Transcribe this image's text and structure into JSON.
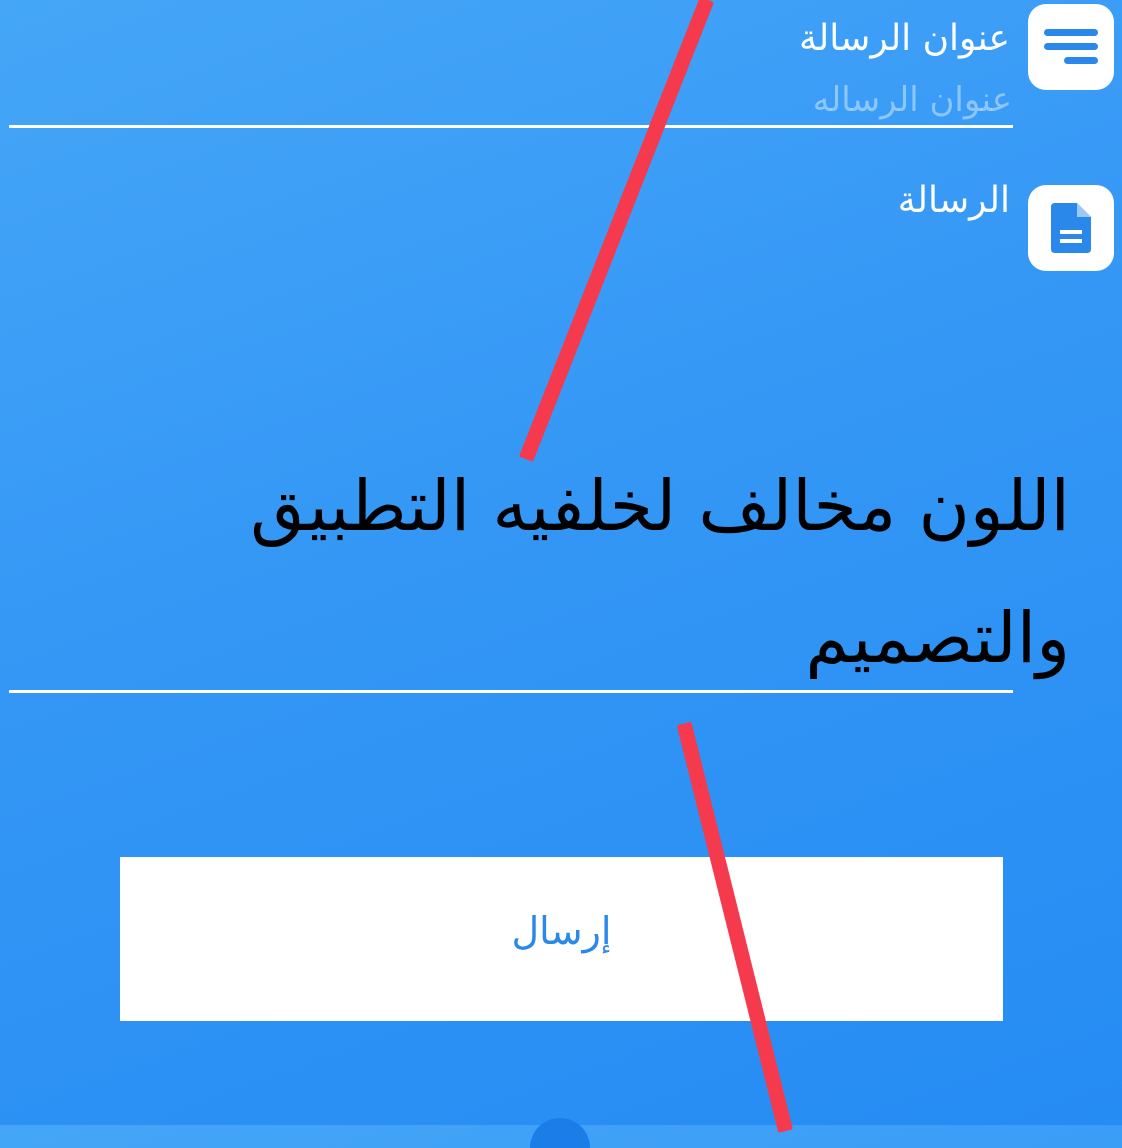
{
  "form": {
    "title_field": {
      "label": "عنوان الرسالة",
      "value": "",
      "placeholder": "عنوان الرساله",
      "icon": "short-text-icon"
    },
    "message_field": {
      "label": "الرسالة",
      "value": "اللون مخالف لخلفيه التطبيق والتصميم",
      "icon": "document-icon"
    },
    "send_button": {
      "label": "إرسال"
    }
  },
  "colors": {
    "background": "#3497f5",
    "accent": "#2a88ea",
    "annotation": "#f53a4e"
  }
}
